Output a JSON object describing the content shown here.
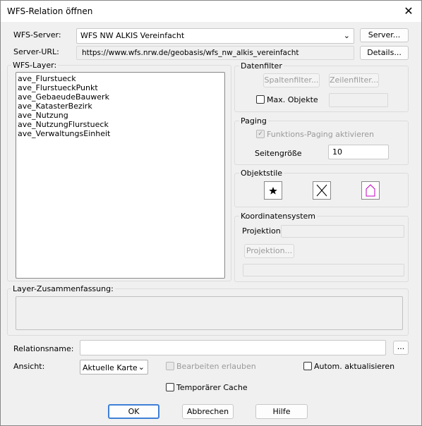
{
  "window": {
    "title": "WFS-Relation öffnen"
  },
  "server": {
    "label": "WFS-Server:",
    "value": "WFS NW ALKIS Vereinfacht",
    "button": "Server..."
  },
  "url": {
    "label": "Server-URL:",
    "value": "https://www.wfs.nrw.de/geobasis/wfs_nw_alkis_vereinfacht",
    "button": "Details..."
  },
  "layers": {
    "label": "WFS-Layer:",
    "items": [
      "ave_Flurstueck",
      "ave_FlurstueckPunkt",
      "ave_GebaeudeBauwerk",
      "ave_KatasterBezirk",
      "ave_Nutzung",
      "ave_NutzungFlurstueck",
      "ave_VerwaltungsEinheit"
    ]
  },
  "datenfilter": {
    "label": "Datenfilter",
    "spaltenfilter": "Spaltenfilter...",
    "zeilenfilter": "Zeilenfilter...",
    "max_objekte": "Max. Objekte",
    "max_objekte_checked": false
  },
  "paging": {
    "label": "Paging",
    "enable": "Funktions-Paging aktivieren",
    "enable_checked": true,
    "page_size_label": "Seitengröße",
    "page_size": "10"
  },
  "objektstile": {
    "label": "Objektstile",
    "icons": [
      "point-style-icon",
      "line-style-icon",
      "polygon-style-icon"
    ]
  },
  "koord": {
    "label": "Koordinatensystem",
    "projektion_label": "Projektion:",
    "projektion_value": "",
    "projektion_button": "Projektion...",
    "extra_value": ""
  },
  "summary": {
    "label": "Layer-Zusammenfassung:",
    "value": ""
  },
  "relation": {
    "label": "Relationsname:",
    "value": "",
    "browse": "..."
  },
  "ansicht": {
    "label": "Ansicht:",
    "value": "Aktuelle Karte",
    "bearbeiten": "Bearbeiten erlauben",
    "autom": "Autom. aktualisieren"
  },
  "temp_cache": "Temporärer Cache",
  "footer": {
    "ok": "OK",
    "cancel": "Abbrechen",
    "help": "Hilfe"
  },
  "colors": {
    "polygon_accent": "#c000c0",
    "default_button_border": "#3f7fd6"
  }
}
